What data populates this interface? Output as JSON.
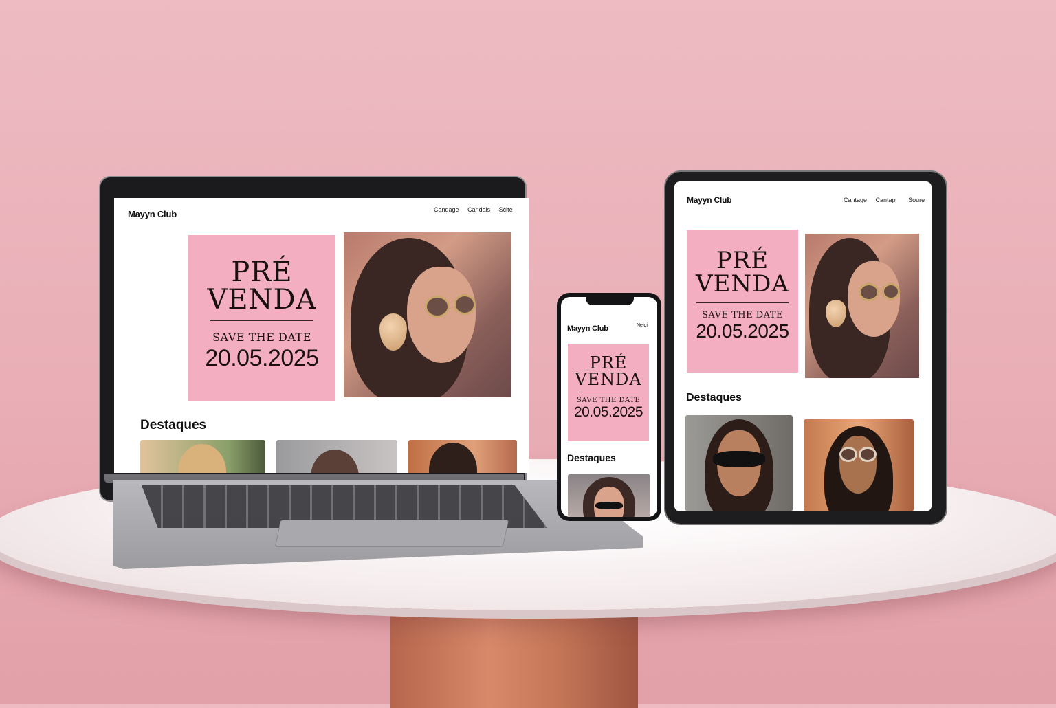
{
  "brand_name": "Mayyn Club",
  "laptop": {
    "nav": [
      "Candage",
      "Candals",
      "Scite"
    ]
  },
  "tablet": {
    "nav": [
      "Cantage",
      "Cantap",
      "Soure"
    ]
  },
  "phone": {
    "nav": [
      "Neldi"
    ]
  },
  "promo": {
    "line1": "PRÉ",
    "line2": "VENDA",
    "subtitle": "SAVE THE DATE",
    "date": "20.05.2025"
  },
  "section_title": "Destaques",
  "colors": {
    "background": "#eebbc2",
    "promo_card": "#f3aec2",
    "pedestal": "#c27455"
  }
}
